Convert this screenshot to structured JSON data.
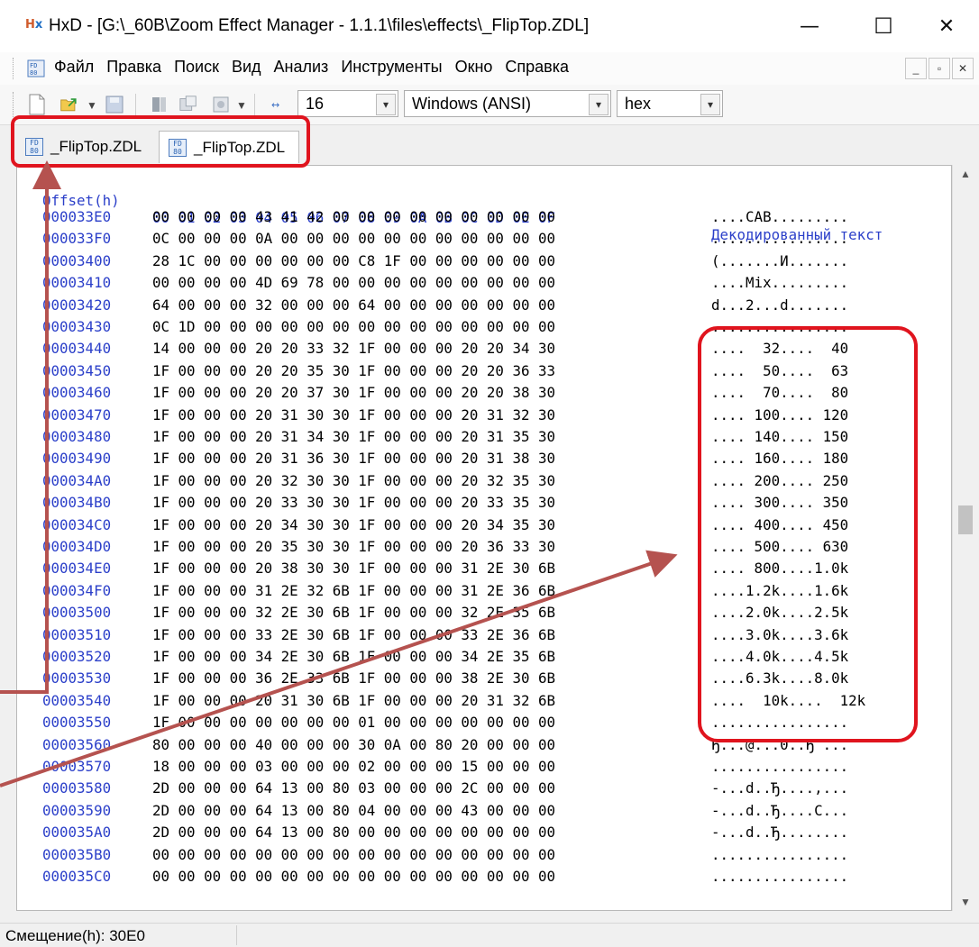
{
  "window": {
    "title": "HxD - [G:\\_60B\\Zoom Effect Manager - 1.1.1\\files\\effects\\_FlipTop.ZDL]",
    "minimize_glyph": "—",
    "maximize_glyph": "☐",
    "close_glyph": "✕"
  },
  "menu": {
    "items": [
      "Файл",
      "Правка",
      "Поиск",
      "Вид",
      "Анализ",
      "Инструменты",
      "Окно",
      "Справка"
    ]
  },
  "toolbar": {
    "bytes_per_row": "16",
    "charset": "Windows (ANSI)",
    "display_mode": "hex",
    "icons": [
      "new-file-icon",
      "open-file-icon",
      "save-icon",
      "tool-icon",
      "tool-icon",
      "tool-icon",
      "columns-icon"
    ]
  },
  "tabs": [
    {
      "label": "_FlipTop.ZDL",
      "active": false
    },
    {
      "label": "_FlipTop.ZDL",
      "active": true
    }
  ],
  "editor": {
    "header": {
      "offset": "Offset(h)",
      "hex": "00 01 02 03 04 05 06 07 08 09 0A 0B 0C 0D 0E 0F",
      "text": "Декодированный текст"
    },
    "rows": [
      {
        "offset": "000033E0",
        "hex": "00 00 00 00 43 41 42 00 00 00 00 00 00 00 00 00",
        "text": "....CAB........."
      },
      {
        "offset": "000033F0",
        "hex": "0C 00 00 00 0A 00 00 00 00 00 00 00 00 00 00 00",
        "text": "................"
      },
      {
        "offset": "00003400",
        "hex": "28 1C 00 00 00 00 00 00 C8 1F 00 00 00 00 00 00",
        "text": "(.......И......."
      },
      {
        "offset": "00003410",
        "hex": "00 00 00 00 4D 69 78 00 00 00 00 00 00 00 00 00",
        "text": "....Mix........."
      },
      {
        "offset": "00003420",
        "hex": "64 00 00 00 32 00 00 00 64 00 00 00 00 00 00 00",
        "text": "d...2...d......."
      },
      {
        "offset": "00003430",
        "hex": "0C 1D 00 00 00 00 00 00 00 00 00 00 00 00 00 00",
        "text": "................"
      },
      {
        "offset": "00003440",
        "hex": "14 00 00 00 20 20 33 32 1F 00 00 00 20 20 34 30",
        "text": "....  32....  40"
      },
      {
        "offset": "00003450",
        "hex": "1F 00 00 00 20 20 35 30 1F 00 00 00 20 20 36 33",
        "text": "....  50....  63"
      },
      {
        "offset": "00003460",
        "hex": "1F 00 00 00 20 20 37 30 1F 00 00 00 20 20 38 30",
        "text": "....  70....  80"
      },
      {
        "offset": "00003470",
        "hex": "1F 00 00 00 20 31 30 30 1F 00 00 00 20 31 32 30",
        "text": ".... 100.... 120"
      },
      {
        "offset": "00003480",
        "hex": "1F 00 00 00 20 31 34 30 1F 00 00 00 20 31 35 30",
        "text": ".... 140.... 150"
      },
      {
        "offset": "00003490",
        "hex": "1F 00 00 00 20 31 36 30 1F 00 00 00 20 31 38 30",
        "text": ".... 160.... 180"
      },
      {
        "offset": "000034A0",
        "hex": "1F 00 00 00 20 32 30 30 1F 00 00 00 20 32 35 30",
        "text": ".... 200.... 250"
      },
      {
        "offset": "000034B0",
        "hex": "1F 00 00 00 20 33 30 30 1F 00 00 00 20 33 35 30",
        "text": ".... 300.... 350"
      },
      {
        "offset": "000034C0",
        "hex": "1F 00 00 00 20 34 30 30 1F 00 00 00 20 34 35 30",
        "text": ".... 400.... 450"
      },
      {
        "offset": "000034D0",
        "hex": "1F 00 00 00 20 35 30 30 1F 00 00 00 20 36 33 30",
        "text": ".... 500.... 630"
      },
      {
        "offset": "000034E0",
        "hex": "1F 00 00 00 20 38 30 30 1F 00 00 00 31 2E 30 6B",
        "text": ".... 800....1.0k"
      },
      {
        "offset": "000034F0",
        "hex": "1F 00 00 00 31 2E 32 6B 1F 00 00 00 31 2E 36 6B",
        "text": "....1.2k....1.6k"
      },
      {
        "offset": "00003500",
        "hex": "1F 00 00 00 32 2E 30 6B 1F 00 00 00 32 2E 35 6B",
        "text": "....2.0k....2.5k"
      },
      {
        "offset": "00003510",
        "hex": "1F 00 00 00 33 2E 30 6B 1F 00 00 00 33 2E 36 6B",
        "text": "....3.0k....3.6k"
      },
      {
        "offset": "00003520",
        "hex": "1F 00 00 00 34 2E 30 6B 1F 00 00 00 34 2E 35 6B",
        "text": "....4.0k....4.5k"
      },
      {
        "offset": "00003530",
        "hex": "1F 00 00 00 36 2E 33 6B 1F 00 00 00 38 2E 30 6B",
        "text": "....6.3k....8.0k"
      },
      {
        "offset": "00003540",
        "hex": "1F 00 00 00 20 31 30 6B 1F 00 00 00 20 31 32 6B",
        "text": "....  10k....  12k"
      },
      {
        "offset": "00003550",
        "hex": "1F 00 00 00 00 00 00 00 01 00 00 00 00 00 00 00",
        "text": "................"
      },
      {
        "offset": "00003560",
        "hex": "80 00 00 00 40 00 00 00 30 0A 00 80 20 00 00 00",
        "text": "Ђ...@...0..Ђ ..."
      },
      {
        "offset": "00003570",
        "hex": "18 00 00 00 03 00 00 00 02 00 00 00 15 00 00 00",
        "text": "................"
      },
      {
        "offset": "00003580",
        "hex": "2D 00 00 00 64 13 00 80 03 00 00 00 2C 00 00 00",
        "text": "-...d..Ђ....,..."
      },
      {
        "offset": "00003590",
        "hex": "2D 00 00 00 64 13 00 80 04 00 00 00 43 00 00 00",
        "text": "-...d..Ђ....C..."
      },
      {
        "offset": "000035A0",
        "hex": "2D 00 00 00 64 13 00 80 00 00 00 00 00 00 00 00",
        "text": "-...d..Ђ........"
      },
      {
        "offset": "000035B0",
        "hex": "00 00 00 00 00 00 00 00 00 00 00 00 00 00 00 00",
        "text": "................"
      },
      {
        "offset": "000035C0",
        "hex": "00 00 00 00 00 00 00 00 00 00 00 00 00 00 00 00",
        "text": "................"
      }
    ]
  },
  "scrollbar": {
    "up_glyph": "▲",
    "down_glyph": "▼"
  },
  "status": {
    "offset_label": "Смещение(h): 30E0"
  },
  "annotation_color": "#e0141e",
  "arrow_color": "#b5524f"
}
